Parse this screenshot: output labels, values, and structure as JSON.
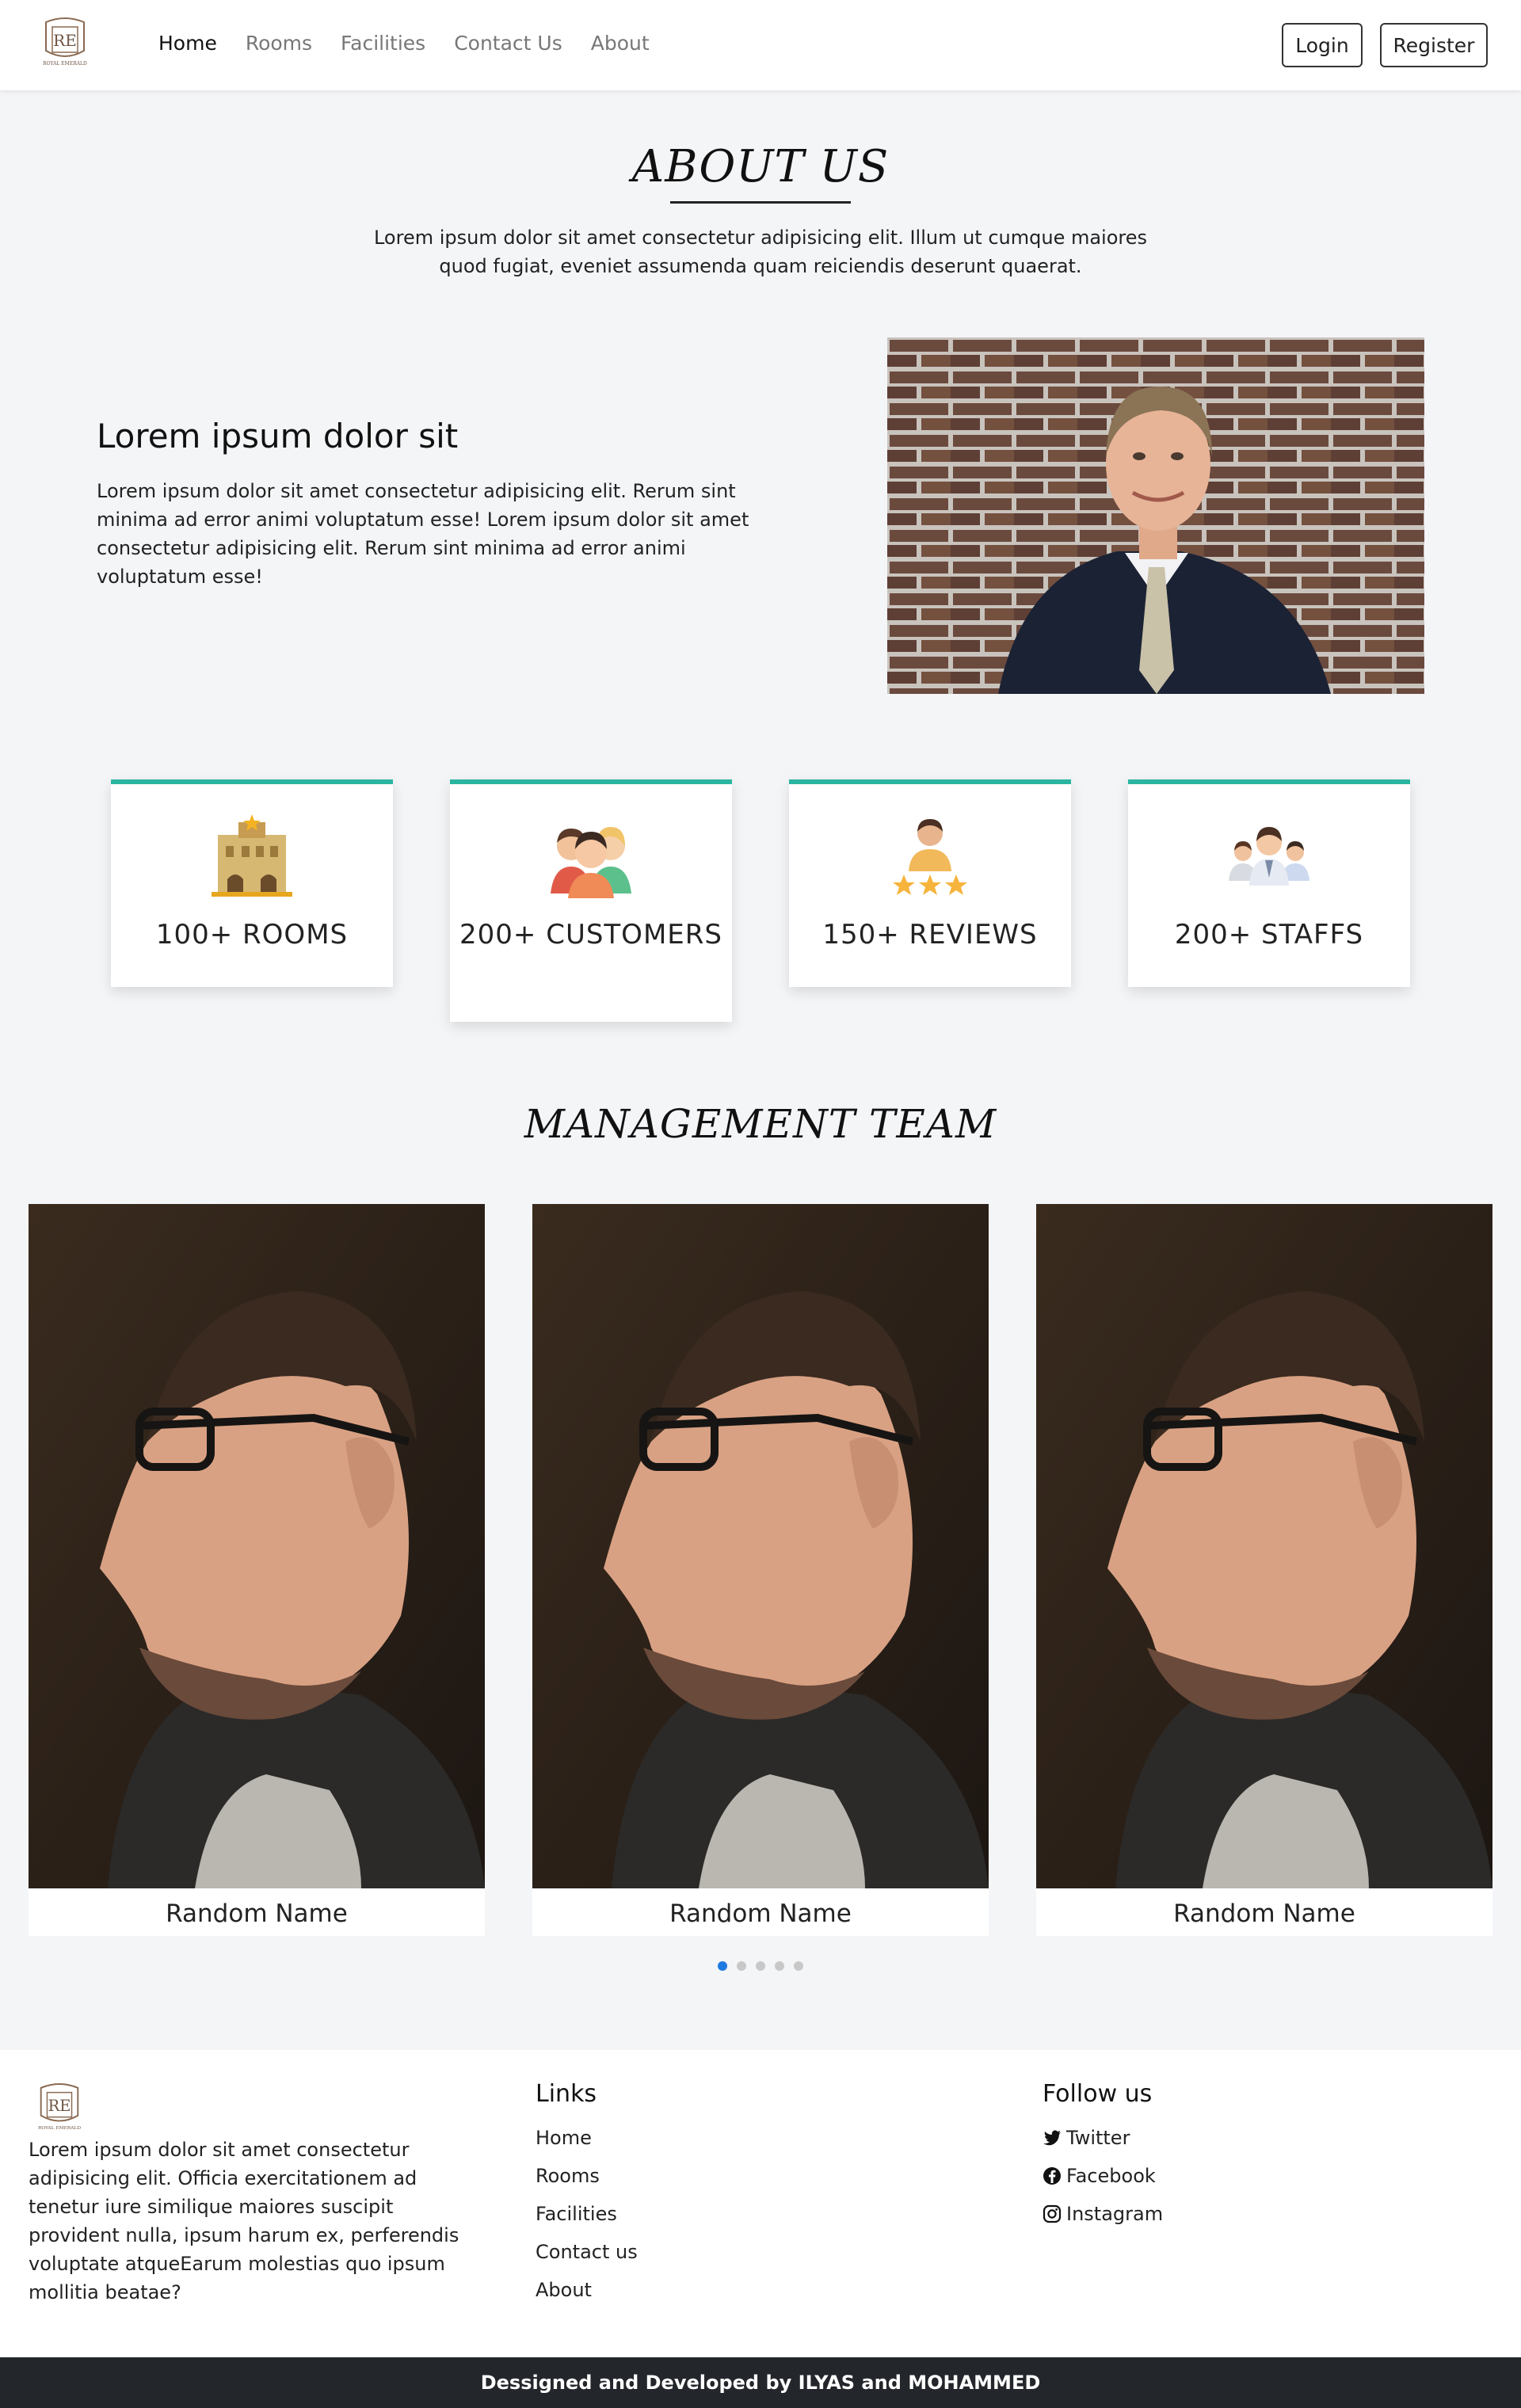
{
  "nav": {
    "links": [
      "Home",
      "Rooms",
      "Facilities",
      "Contact Us",
      "About"
    ],
    "login": "Login",
    "register": "Register",
    "logo_text": "ROYAL EMERALD",
    "logo_monogram": "RE"
  },
  "about": {
    "title": "ABOUT US",
    "subtitle": "Lorem ipsum dolor sit amet consectetur adipisicing elit. Illum ut cumque maiores quod fugiat, eveniet assumenda quam reiciendis deserunt quaerat.",
    "heading": "Lorem ipsum dolor sit",
    "text": "Lorem ipsum dolor sit amet consectetur adipisicing elit. Rerum sint minima ad error animi voluptatum esse! Lorem ipsum dolor sit amet consectetur adipisicing elit. Rerum sint minima ad error animi voluptatum esse!"
  },
  "stats": [
    {
      "label": "100+ ROOMS",
      "icon": "hotel-building-icon"
    },
    {
      "label": "200+ CUSTOMERS",
      "icon": "customers-group-icon"
    },
    {
      "label": "150+ REVIEWS",
      "icon": "reviews-stars-icon"
    },
    {
      "label": "200+ STAFFS",
      "icon": "staff-team-icon"
    }
  ],
  "team": {
    "title": "MANAGEMENT TEAM",
    "members": [
      {
        "name": "Random Name"
      },
      {
        "name": "Random Name"
      },
      {
        "name": "Random Name"
      }
    ],
    "carousel_pages": 5,
    "active_page": 1
  },
  "footer": {
    "text": "Lorem ipsum dolor sit amet consectetur adipisicing elit. Officia exercitationem ad tenetur iure similique maiores suscipit provident nulla, ipsum harum ex, perferendis voluptate atqueEarum molestias quo ipsum mollitia beatae?",
    "links_title": "Links",
    "links": [
      "Home",
      "Rooms",
      "Facilities",
      "Contact us",
      "About"
    ],
    "follow_title": "Follow us",
    "social": [
      {
        "label": "Twitter",
        "icon": "twitter-icon"
      },
      {
        "label": "Facebook",
        "icon": "facebook-icon"
      },
      {
        "label": "Instagram",
        "icon": "instagram-icon"
      }
    ],
    "credit": "Dessigned and Developed by ILYAS and MOHAMMED"
  },
  "colors": {
    "accent": "#2bb5a0",
    "dot_active": "#1f7ae0",
    "footer_bar": "#23262b"
  }
}
